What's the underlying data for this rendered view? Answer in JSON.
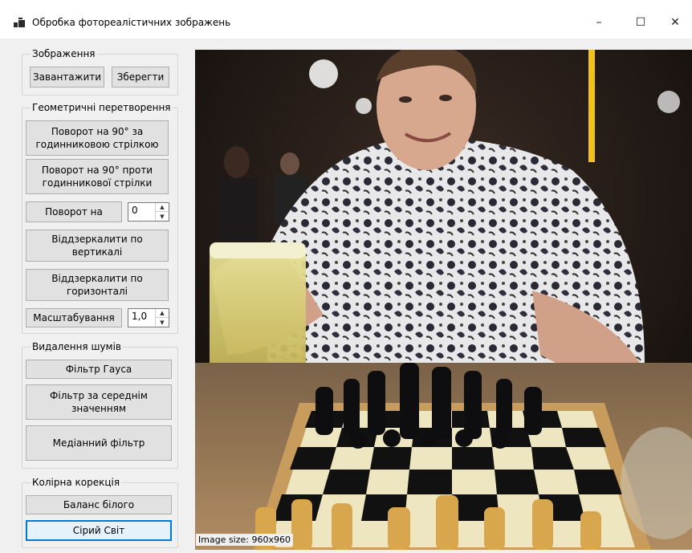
{
  "window": {
    "title": "Обробка фотореалістичних зображень",
    "icon": "app-window-icon",
    "minimize": "–",
    "maximize": "☐",
    "close": "✕"
  },
  "groups": {
    "image": {
      "label": "Зображення",
      "load": "Завантажити",
      "save": "Зберегти"
    },
    "geometry": {
      "label": "Геометричні перетворення",
      "rotate_cw": "Поворот на 90° за годинниковою стрілкою",
      "rotate_ccw": "Поворот на 90° проти годинникової стрілки",
      "rotate_by": "Поворот на",
      "rotate_value": "0",
      "flip_vertical": "Віддзеркалити по вертикалі",
      "flip_horizontal": "Віддзеркалити по горизонталі",
      "scale": "Масштабування",
      "scale_value": "1,0"
    },
    "noise": {
      "label": "Видалення шумів",
      "gauss": "Фільтр Гауса",
      "mean": "Фільтр за середнім значенням",
      "median": "Медіанний фільтр"
    },
    "color": {
      "label": "Колірна корекція",
      "white_balance": "Баланс білого",
      "gray_world": "Сірий Світ"
    }
  },
  "picture": {
    "size_label": "Image size: 960x960",
    "description_icon": "photo-chess-player"
  },
  "colors": {
    "accent": "#0078d7",
    "button_bg": "#e1e1e1",
    "window_bg": "#f0f0f0"
  }
}
